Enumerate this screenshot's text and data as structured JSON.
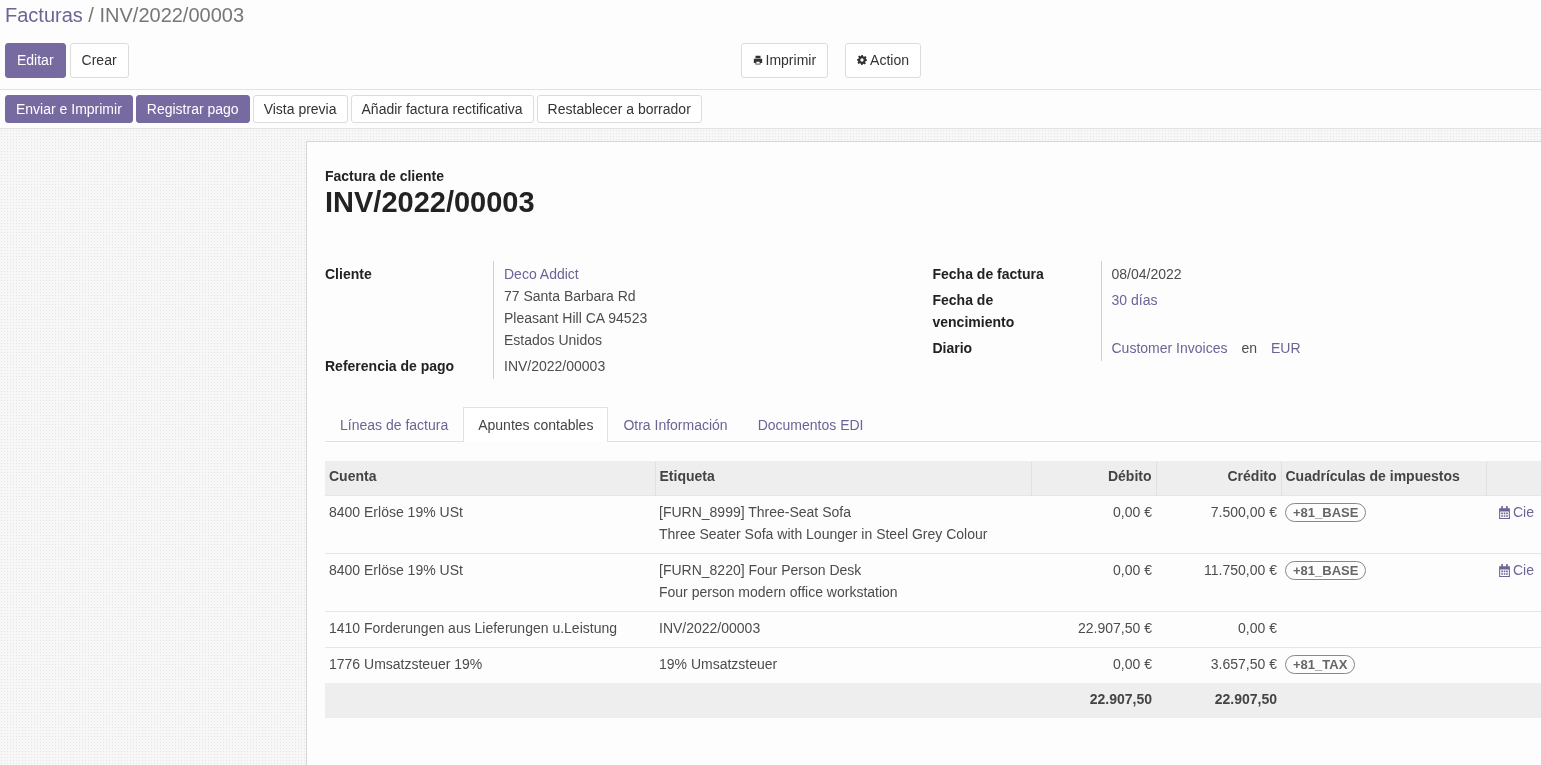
{
  "breadcrumb": {
    "parent": "Facturas",
    "separator": "/",
    "current": "INV/2022/00003"
  },
  "toolbar": {
    "buttons": [
      {
        "label": "Editar",
        "kind": "primary"
      },
      {
        "label": "Crear",
        "kind": "secondary"
      }
    ],
    "actions": [
      {
        "label": "Imprimir",
        "kind": "print"
      },
      {
        "label": "Action",
        "kind": "gear"
      }
    ]
  },
  "status_bar": {
    "buttons": [
      {
        "label": "Enviar e Imprimir",
        "kind": "primary"
      },
      {
        "label": "Registrar pago",
        "kind": "primary"
      },
      {
        "label": "Vista previa",
        "kind": "secondary"
      },
      {
        "label": "Añadir factura rectificativa",
        "kind": "secondary"
      },
      {
        "label": "Restablecer a borrador",
        "kind": "secondary"
      }
    ]
  },
  "form": {
    "type_label": "Factura de cliente",
    "number": "INV/2022/00003",
    "left_fields": [
      {
        "label": "Cliente",
        "kind": "lines",
        "parts": [
          {
            "text": "Deco Addict",
            "kind": "link"
          },
          {
            "text": "77 Santa Barbara Rd",
            "kind": "text"
          },
          {
            "text": "Pleasant Hill CA 94523",
            "kind": "text"
          },
          {
            "text": "Estados Unidos",
            "kind": "text"
          }
        ]
      },
      {
        "label": "Referencia de pago",
        "kind": "lines",
        "parts": [
          {
            "text": "INV/2022/00003",
            "kind": "text"
          }
        ]
      }
    ],
    "right_fields": [
      {
        "label": "Fecha de factura",
        "kind": "lines",
        "parts": [
          {
            "text": "08/04/2022",
            "kind": "text"
          }
        ]
      },
      {
        "label": "Fecha de vencimiento",
        "kind": "lines",
        "parts": [
          {
            "text": "30 días",
            "kind": "link"
          }
        ]
      },
      {
        "label": "Diario",
        "kind": "inline",
        "parts": [
          {
            "text": "Customer Invoices",
            "kind": "link"
          },
          {
            "text": "en",
            "kind": "text"
          },
          {
            "text": "EUR",
            "kind": "link"
          }
        ]
      }
    ]
  },
  "tabs": [
    {
      "label": "Líneas de factura",
      "selected": false
    },
    {
      "label": "Apuntes contables",
      "selected": true
    },
    {
      "label": "Otra Información",
      "selected": false
    },
    {
      "label": "Documentos EDI",
      "selected": false
    }
  ],
  "table": {
    "columns": [
      {
        "label": "Cuenta",
        "kind": "text"
      },
      {
        "label": "Etiqueta",
        "kind": "text"
      },
      {
        "label": "Débito",
        "kind": "amount"
      },
      {
        "label": "Crédito",
        "kind": "amount"
      },
      {
        "label": "Cuadrículas de impuestos",
        "kind": "text"
      }
    ],
    "rows": [
      {
        "account": "8400 Erlöse 19% USt",
        "label_lines": [
          "[FURN_8999] Three-Seat Sofa",
          "Three Seater Sofa with Lounger in Steel Grey Colour"
        ],
        "debit": "0,00 €",
        "credit": "7.500,00 €",
        "tags": [
          "+81_BASE"
        ],
        "action": "Cie"
      },
      {
        "account": "8400 Erlöse 19% USt",
        "label_lines": [
          "[FURN_8220] Four Person Desk",
          "Four person modern office workstation"
        ],
        "debit": "0,00 €",
        "credit": "11.750,00 €",
        "tags": [
          "+81_BASE"
        ],
        "action": "Cie"
      },
      {
        "account": "1410 Forderungen aus Lieferungen u.Leistung",
        "label_lines": [
          "INV/2022/00003"
        ],
        "debit": "22.907,50 €",
        "credit": "0,00 €",
        "tags": []
      },
      {
        "account": "1776 Umsatzsteuer 19%",
        "label_lines": [
          "19% Umsatzsteuer"
        ],
        "debit": "0,00 €",
        "credit": "3.657,50 €",
        "tags": [
          "+81_TAX"
        ]
      }
    ],
    "totals": {
      "debit": "22.907,50",
      "credit": "22.907,50"
    }
  }
}
